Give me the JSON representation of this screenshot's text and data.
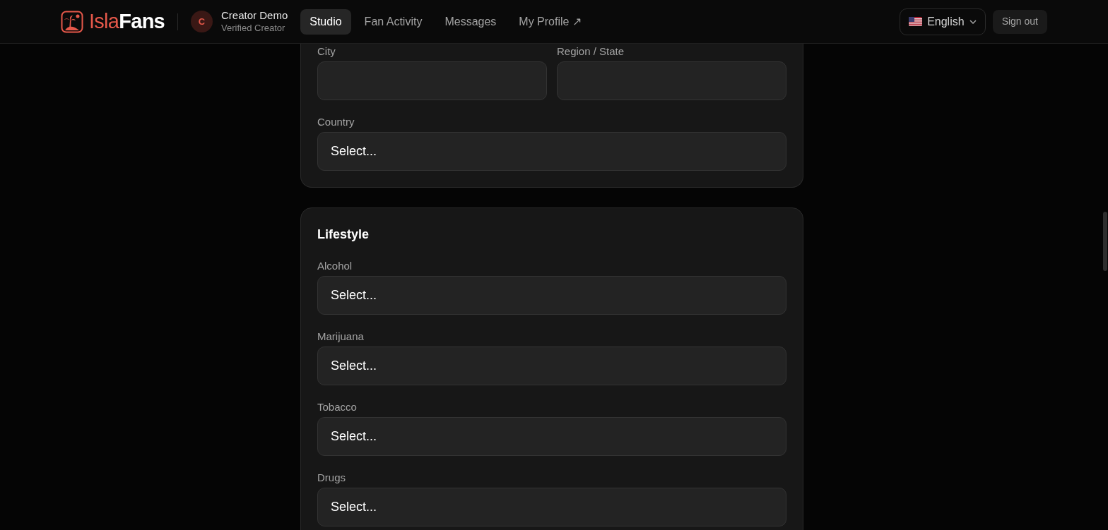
{
  "header": {
    "logo": {
      "part_1": "Isla",
      "part_2": "Fans"
    },
    "user": {
      "initial": "C",
      "name": "Creator Demo",
      "role": "Verified Creator"
    },
    "nav": [
      {
        "label": "Studio",
        "selected": true
      },
      {
        "label": "Fan Activity",
        "selected": false
      },
      {
        "label": "Messages",
        "selected": false
      },
      {
        "label": "My Profile ↗",
        "selected": false
      }
    ],
    "language": "English",
    "sign_out": "Sign out"
  },
  "sections": [
    {
      "rows": [
        [
          {
            "label": "City"
          },
          {
            "label": "Region / State"
          }
        ],
        [
          {
            "label": "Country",
            "value": "Select..."
          }
        ]
      ]
    },
    {
      "title": "Lifestyle",
      "rows": [
        [
          {
            "label": "Alcohol",
            "value": "Select..."
          }
        ],
        [
          {
            "label": "Marijuana",
            "value": "Select..."
          }
        ],
        [
          {
            "label": "Tobacco",
            "value": "Select..."
          }
        ],
        [
          {
            "label": "Drugs",
            "value": "Select..."
          }
        ]
      ]
    }
  ]
}
